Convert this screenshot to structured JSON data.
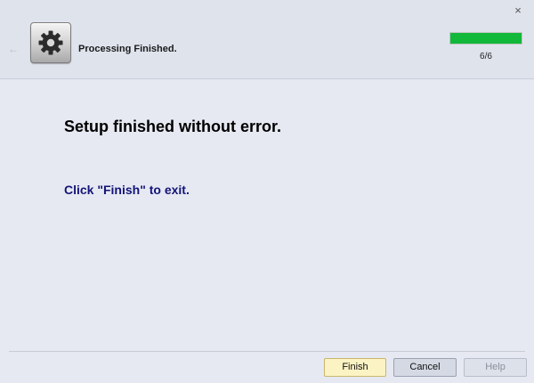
{
  "window": {
    "close_glyph": "×"
  },
  "header": {
    "back_glyph": "←",
    "icon": "gear-icon",
    "title": "Processing Finished.",
    "progress": {
      "fraction": 1.0,
      "text": "6/6",
      "color": "#12b83a"
    }
  },
  "main": {
    "headline": "Setup finished without error.",
    "instruction": "Click \"Finish\" to exit."
  },
  "footer": {
    "finish_label": "Finish",
    "cancel_label": "Cancel",
    "help_label": "Help"
  }
}
